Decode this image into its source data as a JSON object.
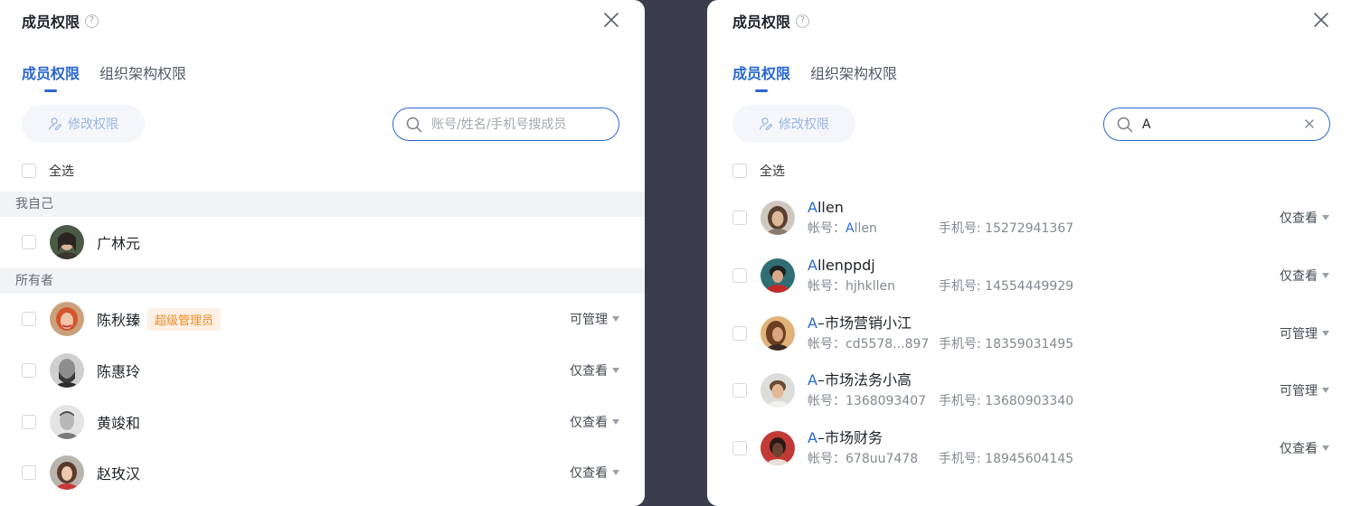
{
  "left": {
    "title": "成员权限",
    "help": "?",
    "tabs": [
      "成员权限",
      "组织架构权限"
    ],
    "edit_button": "修改权限",
    "search_placeholder": "账号/姓名/手机号搜成员",
    "search_value": "",
    "select_all": "全选",
    "groups": [
      {
        "label": "我自己",
        "members": [
          {
            "name": "广林元",
            "badge": "",
            "perm": ""
          }
        ]
      },
      {
        "label": "所有者",
        "members": [
          {
            "name": "陈秋臻",
            "badge": "超级管理员",
            "perm": "可管理"
          },
          {
            "name": "陈惠玲",
            "badge": "",
            "perm": "仅查看"
          },
          {
            "name": "黄竣和",
            "badge": "",
            "perm": "仅查看"
          },
          {
            "name": "赵玫汉",
            "badge": "",
            "perm": "仅查看"
          }
        ]
      }
    ]
  },
  "right": {
    "title": "成员权限",
    "help": "?",
    "tabs": [
      "成员权限",
      "组织架构权限"
    ],
    "edit_button": "修改权限",
    "search_placeholder": "账号/姓名/手机号搜成员",
    "search_value": "A",
    "select_all": "全选",
    "results": [
      {
        "name_hl": "A",
        "name_rest": "llen",
        "acct_label": "帐号：",
        "acct_hl": "A",
        "acct_rest": "llen",
        "phone": "手机号: 15272941367",
        "perm": "仅查看"
      },
      {
        "name_hl": "A",
        "name_rest": "llenppdj",
        "acct_label": "帐号：",
        "acct_hl": "",
        "acct_rest": "hjhkllen",
        "phone": "手机号: 14554449929",
        "perm": "仅查看"
      },
      {
        "name_hl": "A",
        "name_rest": "–市场营销小江",
        "acct_label": "帐号：",
        "acct_hl": "",
        "acct_rest": "cd5578...897",
        "phone": "手机号: 18359031495",
        "perm": "可管理"
      },
      {
        "name_hl": "A",
        "name_rest": "–市场法务小高",
        "acct_label": "帐号：",
        "acct_hl": "",
        "acct_rest": "1368093407",
        "phone": "手机号: 13680903340",
        "perm": "可管理"
      },
      {
        "name_hl": "A",
        "name_rest": "–市场财务",
        "acct_label": "帐号：",
        "acct_hl": "",
        "acct_rest": "678uu7478",
        "phone": "手机号: 18945604145",
        "perm": "仅查看"
      }
    ]
  },
  "colors": {
    "accent": "#2a68d0",
    "badge_text": "#f08a24",
    "badge_bg": "#fdf0e4",
    "backdrop": "#3a3d4b"
  }
}
